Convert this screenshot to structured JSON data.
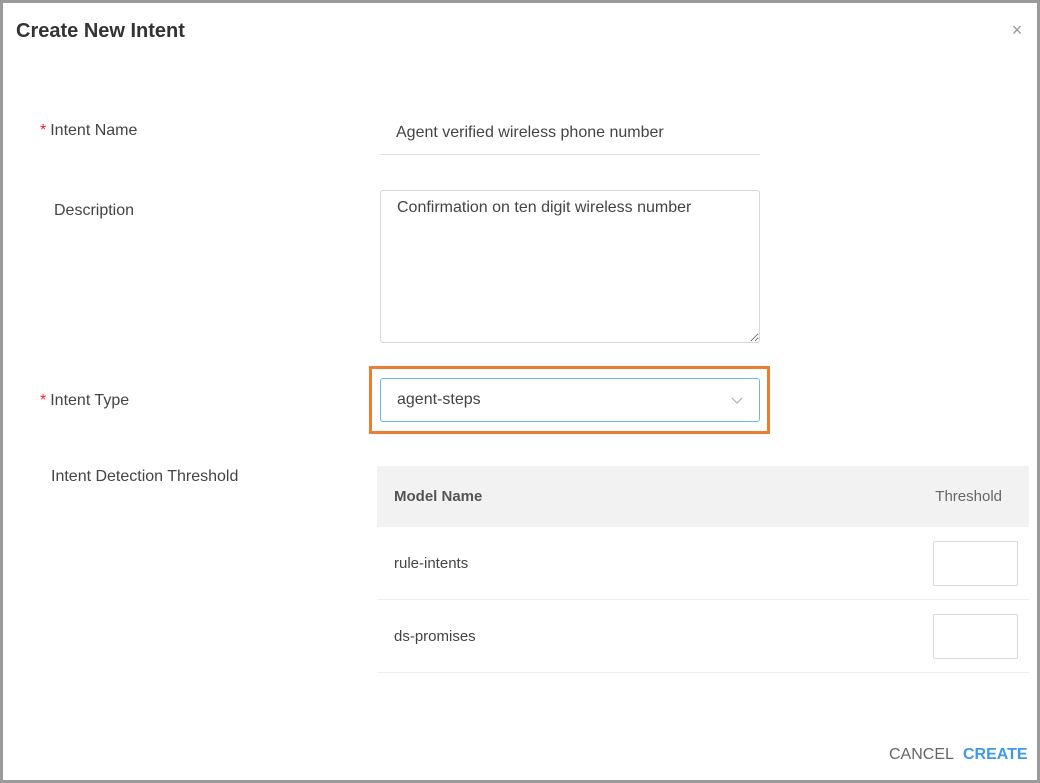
{
  "dialog": {
    "title": "Create New Intent",
    "close_glyph": "×"
  },
  "form": {
    "intent_name": {
      "required": true,
      "required_mark": "*",
      "label": "Intent Name",
      "value": "Agent verified wireless phone number"
    },
    "description": {
      "label": "Description",
      "value": "Confirmation on ten digit wireless number"
    },
    "intent_type": {
      "required": true,
      "required_mark": "*",
      "label": "Intent Type",
      "value": "agent-steps"
    },
    "threshold": {
      "label": "Intent Detection Threshold",
      "columns": {
        "model": "Model Name",
        "threshold": "Threshold"
      },
      "rows": [
        {
          "model": "rule-intents",
          "threshold": ""
        },
        {
          "model": "ds-promises",
          "threshold": ""
        }
      ]
    }
  },
  "footer": {
    "cancel_label": "CANCEL",
    "create_label": "CREATE"
  },
  "colors": {
    "accent": "#3c9ae8",
    "highlight": "#ed7d31",
    "required": "#f5222d"
  },
  "icons": {
    "close": "close-icon",
    "select": "chevron-down-icon"
  }
}
